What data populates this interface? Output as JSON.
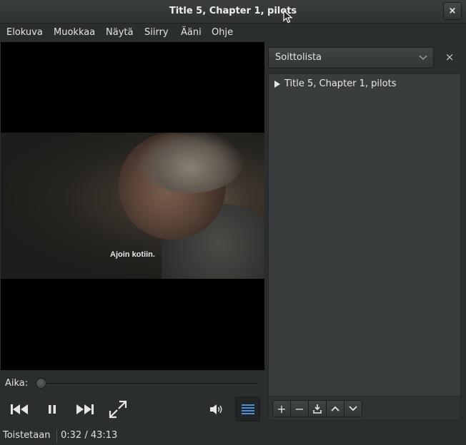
{
  "window": {
    "title": "Title 5, Chapter 1, pilots",
    "close_label": "×"
  },
  "menu": [
    {
      "label": "Elokuva"
    },
    {
      "label": "Muokkaa"
    },
    {
      "label": "Näytä"
    },
    {
      "label": "Siirry"
    },
    {
      "label": "Ääni"
    },
    {
      "label": "Ohje"
    }
  ],
  "video": {
    "subtitle": "Ajoin kotiin."
  },
  "seek": {
    "label": "Aika:",
    "position": 0.0
  },
  "controls": {
    "icons": [
      "previous-icon",
      "pause-icon",
      "next-icon",
      "fullscreen-icon",
      "volume-icon",
      "playlist-toggle-icon"
    ]
  },
  "status": {
    "state": "Toistetaan",
    "time": "0:32 / 43:13"
  },
  "sidebar": {
    "selector_value": "Soittolista",
    "close_label": "×",
    "items": [
      {
        "title": "Title 5, Chapter 1, pilots",
        "playing": true
      }
    ],
    "toolbar": {
      "add_label": "+",
      "remove_label": "−"
    }
  },
  "colors": {
    "window_bg": "#2b2e2f",
    "panel_bg": "#3a3d3e",
    "accent": "#4a90d9"
  }
}
